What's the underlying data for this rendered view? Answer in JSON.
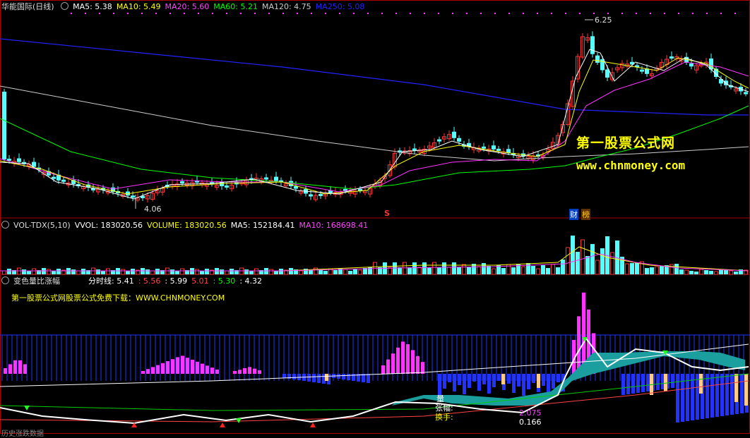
{
  "main_panel": {
    "title": "华能国际(日线)",
    "ma_labels": [
      {
        "text": "MA5: 5.38",
        "color": "#ffffff"
      },
      {
        "text": "MA10: 5.49",
        "color": "#ffff00"
      },
      {
        "text": "MA20: 5.60",
        "color": "#ff44ff"
      },
      {
        "text": "MA60: 5.21",
        "color": "#00ff00"
      },
      {
        "text": "MA120: 4.75",
        "color": "#cccccc"
      },
      {
        "text": "MA250: 5.08",
        "color": "#2222ff"
      }
    ],
    "high_label": "6.25",
    "low_label": "4.06",
    "marker_s": "S",
    "marker_cai": "财",
    "marker_bang": "榜",
    "watermark_cn": "第一股票公式网",
    "watermark_url": "www.chnmoney.com"
  },
  "vol_panel": {
    "title": "VOL-TDX(5,10)",
    "labels": [
      {
        "text": "VVOL: 183020.56",
        "color": "#ffffff"
      },
      {
        "text": "VOLUME: 183020.56",
        "color": "#ffff00"
      },
      {
        "text": "MA5: 152184.41",
        "color": "#ffffff"
      },
      {
        "text": "MA10: 168698.41",
        "color": "#ff44ff"
      }
    ]
  },
  "ind_panel": {
    "title": "变色量比涨幅",
    "labels": [
      {
        "text": "分时线: 5.41",
        "color": "#ffffff"
      },
      {
        "text": ": 5.56",
        "color": "#ff4444"
      },
      {
        "text": ": 5.99",
        "color": "#ffffff"
      },
      {
        "text": "5.01",
        "color": "#ff4444"
      },
      {
        "text": ": 5.30",
        "color": "#00ff00"
      },
      {
        "text": ": 4.32",
        "color": "#ffffff"
      }
    ],
    "promo": "第一股票公式网股票公式免费下载：WWW.CHNMONEY.COM",
    "ann_liang": "量",
    "ann_zhangfu": "张幅:",
    "ann_huanshou": "换手:",
    "ann_val1": "2.075",
    "ann_val2": "0.166",
    "bottom_cut": "历史涨跌数据"
  },
  "colors": {
    "up": "#ff3333",
    "down": "#55ffff",
    "ma250": "#2222ff",
    "pink": "#ff33ff",
    "blue_bar": "#2233ff",
    "tan": "#ffcc88",
    "teal": "#1a9e9e"
  }
}
